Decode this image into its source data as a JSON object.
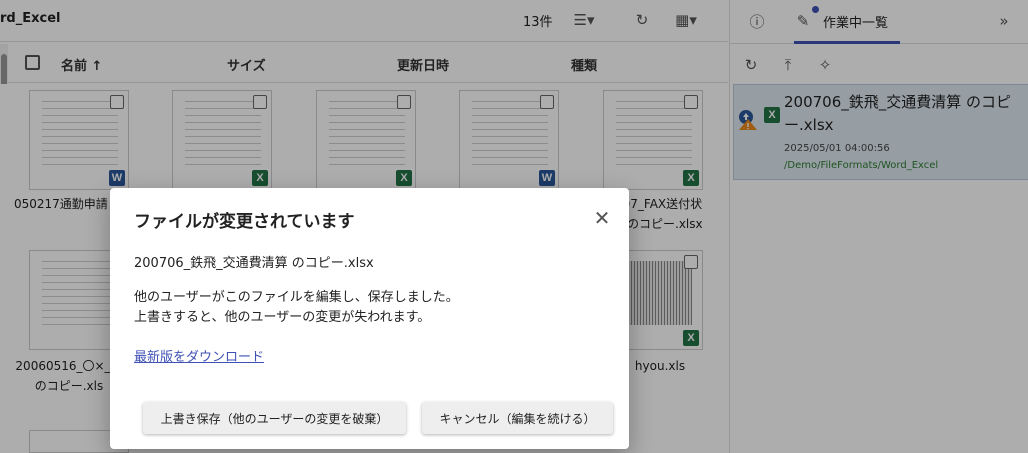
{
  "toolbar": {
    "folder_title": "rd_Excel",
    "count": "13件"
  },
  "columns": {
    "name": "名前",
    "size": "サイズ",
    "updated": "更新日時",
    "type": "種類"
  },
  "files": [
    {
      "name": "050217通勤申請",
      "type": "word"
    },
    {
      "name": "",
      "type": "excel"
    },
    {
      "name": "",
      "type": "excel"
    },
    {
      "name": "",
      "type": "word"
    },
    {
      "name_line1": "907_FAX送付状",
      "name_line2": "のコピー.xlsx",
      "type": "excel"
    },
    {
      "name_line1": "20060516_〇×_請",
      "name_line2": "のコピー.xls",
      "type": "excel"
    },
    {
      "name": "hyou.xls",
      "type": "excel"
    }
  ],
  "panel": {
    "tab_label": "作業中一覧",
    "card": {
      "title": "200706_鉄飛_交通費清算 のコピー.xlsx",
      "date": "2025/05/01 04:00:56",
      "path": "/Demo/FileFormats/Word_Excel"
    }
  },
  "dialog": {
    "title": "ファイルが変更されています",
    "filename": "200706_鉄飛_交通費清算 のコピー.xlsx",
    "message_line1": "他のユーザーがこのファイルを編集し、保存しました。",
    "message_line2": "上書きすると、他のユーザーの変更が失われます。",
    "download_link": "最新版をダウンロード",
    "overwrite_button": "上書き保存（他のユーザーの変更を破棄）",
    "cancel_button": "キャンセル（編集を続ける）"
  },
  "colors": {
    "accent": "#3f51b5",
    "word": "#2b579a",
    "excel": "#217346"
  }
}
